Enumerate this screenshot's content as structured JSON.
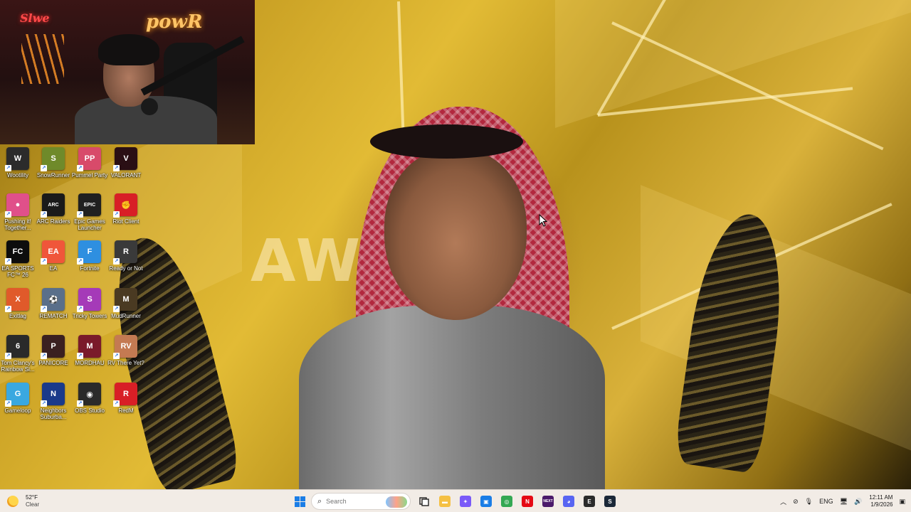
{
  "desktop": {
    "icons": [
      {
        "label": "Wootility",
        "icon": "wootility-icon",
        "color": "#2b2b2b",
        "glyph": "W"
      },
      {
        "label": "SnowRunner",
        "icon": "snowrunner-icon",
        "color": "#6f8a2a",
        "glyph": "S"
      },
      {
        "label": "Pummel Party",
        "icon": "pummel-party-icon",
        "color": "#d84a6a",
        "glyph": "PP"
      },
      {
        "label": "VALORANT",
        "icon": "valorant-icon",
        "color": "#2a0f14",
        "glyph": "V"
      },
      {
        "label": "Pushing it! Together...",
        "icon": "pushing-it-icon",
        "color": "#e0508a",
        "glyph": "●"
      },
      {
        "label": "ARC Raiders",
        "icon": "arc-raiders-icon",
        "color": "#1a1a1a",
        "glyph": "ARC"
      },
      {
        "label": "Epic Games Launcher",
        "icon": "epic-games-icon",
        "color": "#202020",
        "glyph": "EPIC"
      },
      {
        "label": "Riot Client",
        "icon": "riot-client-icon",
        "color": "#d81f26",
        "glyph": "✊"
      },
      {
        "label": "EA SPORTS FC™ 26",
        "icon": "ea-sports-fc-icon",
        "color": "#0d0d0d",
        "glyph": "FC"
      },
      {
        "label": "EA",
        "icon": "ea-icon",
        "color": "#f0563a",
        "glyph": "EA"
      },
      {
        "label": "Fortnite",
        "icon": "fortnite-icon",
        "color": "#2e8fe0",
        "glyph": "F"
      },
      {
        "label": "Ready or Not",
        "icon": "ready-or-not-icon",
        "color": "#3a3a3a",
        "glyph": "R"
      },
      {
        "label": "Exitlag",
        "icon": "exitlag-icon",
        "color": "#e05a2a",
        "glyph": "X"
      },
      {
        "label": "REMATCH",
        "icon": "rematch-icon",
        "color": "#5a6f8a",
        "glyph": "⚽"
      },
      {
        "label": "Tricky Towers",
        "icon": "tricky-towers-icon",
        "color": "#a53ab8",
        "glyph": "S"
      },
      {
        "label": "MudRunner",
        "icon": "mudrunner-icon",
        "color": "#4a3a22",
        "glyph": "M"
      },
      {
        "label": "Tom Clancy's Rainbow Si...",
        "icon": "rainbow-six-icon",
        "color": "#2a2a2a",
        "glyph": "6"
      },
      {
        "label": "PANICORE",
        "icon": "panicore-icon",
        "color": "#3a2020",
        "glyph": "P"
      },
      {
        "label": "MORDHAU",
        "icon": "mordhau-icon",
        "color": "#7a1a2a",
        "glyph": "M"
      },
      {
        "label": "RV There Yet?",
        "icon": "rv-there-yet-icon",
        "color": "#c47a52",
        "glyph": "RV"
      },
      {
        "label": "Gameloop",
        "icon": "gameloop-icon",
        "color": "#3aa8e0",
        "glyph": "G"
      },
      {
        "label": "Neighbors Suburba...",
        "icon": "neighbors-suburbia-icon",
        "color": "#1a3a8a",
        "glyph": "N"
      },
      {
        "label": "OBS Studio",
        "icon": "obs-studio-icon",
        "color": "#2a2a2a",
        "glyph": "◉"
      },
      {
        "label": "RedM",
        "icon": "redm-icon",
        "color": "#d81f26",
        "glyph": "R"
      }
    ],
    "wallpaper_text": "AWA"
  },
  "webcam": {
    "neon_sign": "powR",
    "neon_sign_left": "Slwe"
  },
  "taskbar": {
    "weather": {
      "temp": "52°F",
      "condition": "Clear"
    },
    "search": {
      "placeholder": "Search"
    },
    "pinned": [
      {
        "name": "file-explorer",
        "color": "#f5c043",
        "glyph": "▬"
      },
      {
        "name": "copilot",
        "color": "#7a5af8",
        "glyph": "✦"
      },
      {
        "name": "microsoft-store",
        "color": "#1a7de6",
        "glyph": "▣"
      },
      {
        "name": "chrome",
        "color": "#34a853",
        "glyph": "◎"
      },
      {
        "name": "netflix",
        "color": "#e50914",
        "glyph": "N"
      },
      {
        "name": "next",
        "color": "#4b1a6a",
        "glyph": "NEXT"
      },
      {
        "name": "discord",
        "color": "#5865f2",
        "glyph": "◕"
      },
      {
        "name": "epic-games",
        "color": "#2b2b2b",
        "glyph": "E"
      },
      {
        "name": "steam",
        "color": "#1b2838",
        "glyph": "S"
      }
    ],
    "tray": {
      "language": "ENG",
      "time": "12:11 AM",
      "date": "1/9/2026"
    }
  }
}
